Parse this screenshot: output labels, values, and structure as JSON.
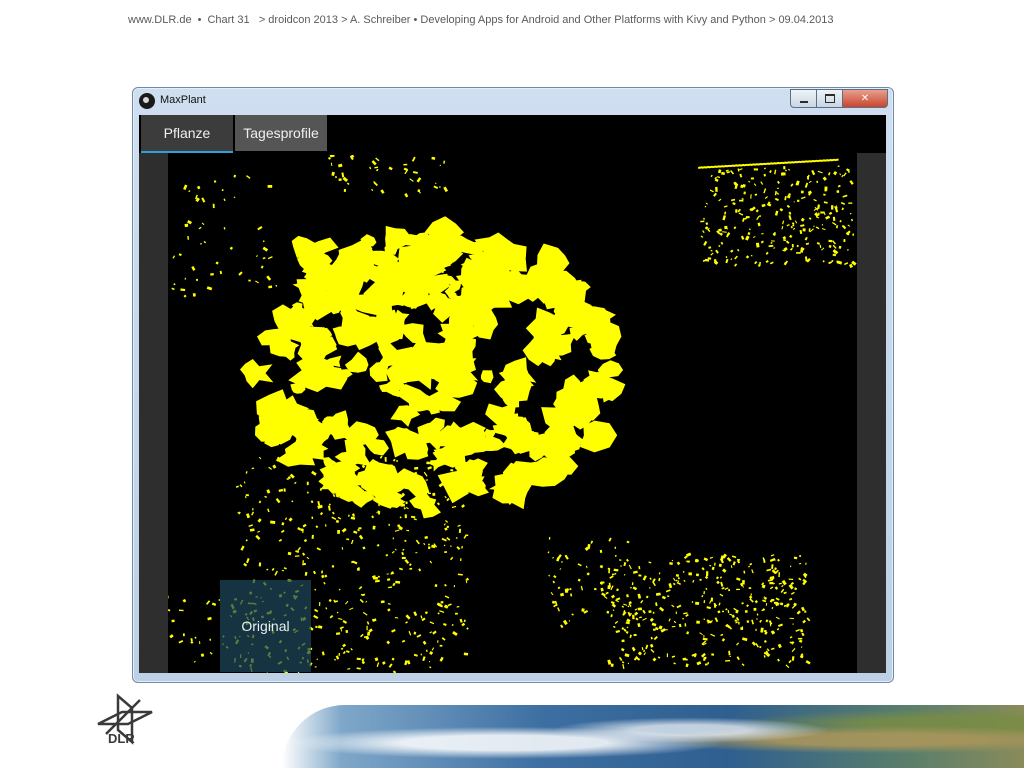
{
  "slide": {
    "site": "www.DLR.de",
    "bullet": "•",
    "chart": "Chart 31",
    "breadcrumb": "> droidcon 2013 > A. Schreiber • Developing Apps for Android and Other Platforms with Kivy and Python > 09.04.2013"
  },
  "window": {
    "title": "MaxPlant",
    "icon": "app-icon",
    "controls": {
      "close": "✕"
    }
  },
  "tabs": [
    {
      "label": "Pflanze",
      "active": true
    },
    {
      "label": "Tagesprofile",
      "active": false
    }
  ],
  "canvas": {
    "background_color": "#000000",
    "plant_color": "#ffff00"
  },
  "original_button": {
    "label": "Original"
  },
  "footer": {
    "logo_text": "DLR"
  }
}
